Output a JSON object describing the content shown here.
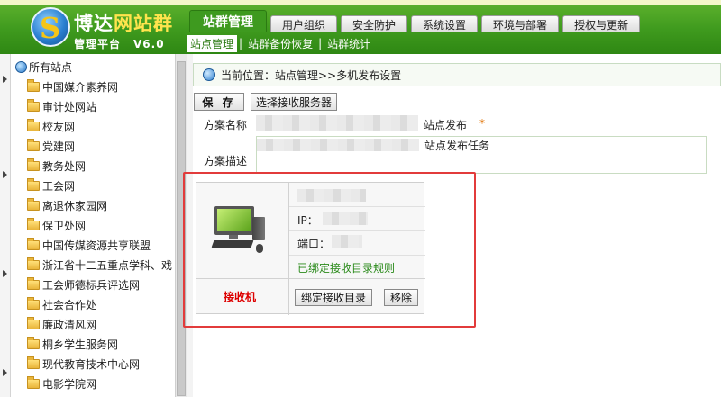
{
  "brand": {
    "name_part1": "博达",
    "name_part2": "网站群",
    "subtitle": "管理平台",
    "version": "V6.0"
  },
  "topnav": [
    "站群管理",
    "用户组织",
    "安全防护",
    "系统设置",
    "环境与部署",
    "授权与更新"
  ],
  "subnav": {
    "items": [
      "站点管理",
      "站群备份恢复",
      "站群统计"
    ],
    "separator": "|"
  },
  "tree": {
    "root": "所有站点",
    "items": [
      "中国媒介素养网",
      "审计处网站",
      "校友网",
      "党建网",
      "教务处网",
      "工会网",
      "离退休家园网",
      "保卫处网",
      "中国传媒资源共享联盟",
      "浙江省十二五重点学科、戏",
      "工会师德标兵评选网",
      "社会合作处",
      "廉政清风网",
      "桐乡学生服务网",
      "现代教育技术中心网",
      "电影学院网"
    ]
  },
  "location": {
    "label": "当前位置：",
    "path": "站点管理>>多机发布设置"
  },
  "toolbar": {
    "save": "保 存",
    "select_server": "选择接收服务器"
  },
  "form": {
    "name_label": "方案名称",
    "name_value_suffix": "站点发布",
    "required_mark": "*",
    "desc_label": "方案描述",
    "desc_value_suffix": "站点发布任务"
  },
  "receiver": {
    "label": "接收机",
    "ip_label": "IP：",
    "port_label": "端口：",
    "status": "已绑定接收目录规则",
    "bind_button": "绑定接收目录",
    "remove_button": "移除"
  },
  "colors": {
    "header_green": "#3f9a1e",
    "highlight_red": "#e23b3b",
    "status_green": "#2a8a1a",
    "receiver_red": "#dd0000"
  }
}
